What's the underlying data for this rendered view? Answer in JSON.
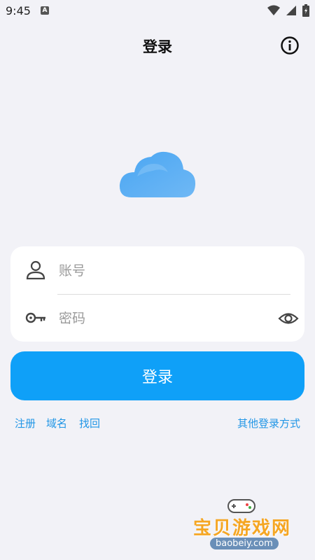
{
  "status_bar": {
    "time": "9:45",
    "notification_letter": "A"
  },
  "header": {
    "title": "登录"
  },
  "form": {
    "account_placeholder": "账号",
    "password_placeholder": "密码"
  },
  "login_button": {
    "label": "登录"
  },
  "links": {
    "register": "注册",
    "domain": "域名",
    "recover": "找回",
    "other_login": "其他登录方式"
  },
  "watermark": {
    "text": "宝贝游戏网",
    "url": "baobeiy.com"
  },
  "colors": {
    "background": "#f2f2f7",
    "primary": "#0fa0f8",
    "link": "#2196e6"
  }
}
